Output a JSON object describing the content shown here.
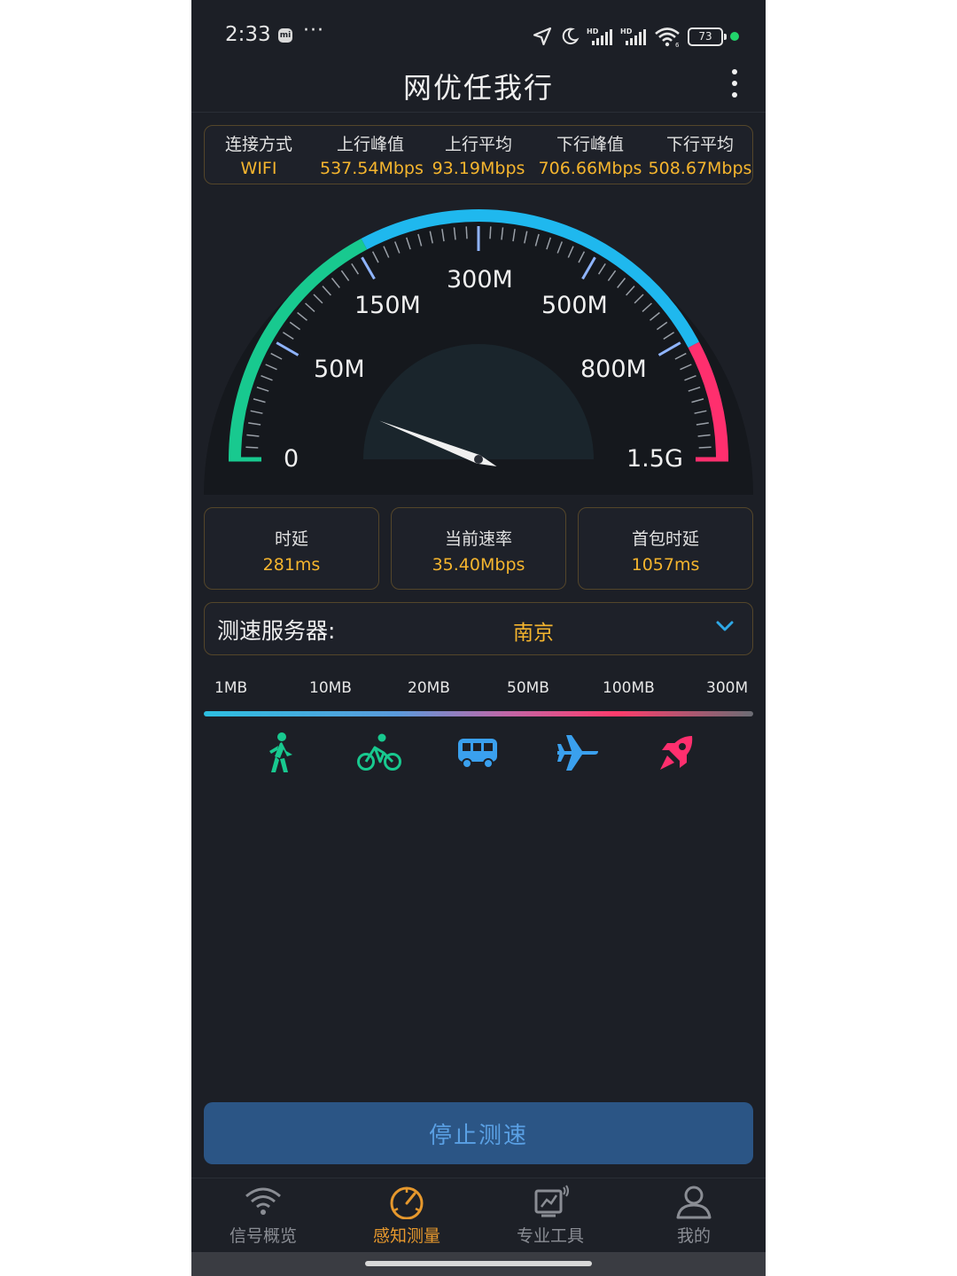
{
  "status_bar": {
    "time": "2:33",
    "ellipsis": "···",
    "battery": "73"
  },
  "app": {
    "title": "网优任我行"
  },
  "summary": {
    "connection_label": "连接方式",
    "connection_value": "WIFI",
    "up_peak_label": "上行峰值",
    "up_peak_value": "537.54Mbps",
    "up_avg_label": "上行平均",
    "up_avg_value": "93.19Mbps",
    "down_peak_label": "下行峰值",
    "down_peak_value": "706.66Mbps",
    "down_avg_label": "下行平均",
    "down_avg_value": "508.67Mbps"
  },
  "gauge": {
    "scale_labels": [
      "0",
      "50M",
      "150M",
      "300M",
      "500M",
      "800M",
      "1.5G"
    ],
    "current_speed_mbps": 35.4,
    "colors": {
      "low": "#18c98f",
      "mid": "#1fb8ee",
      "high": "#ff2f6e"
    }
  },
  "metrics": {
    "latency_label": "时延",
    "latency_value": "281ms",
    "speed_label": "当前速率",
    "speed_value": "35.40Mbps",
    "first_packet_label": "首包时延",
    "first_packet_value": "1057ms"
  },
  "server": {
    "label": "测速服务器:",
    "value": "南京"
  },
  "sizes": [
    "1MB",
    "10MB",
    "20MB",
    "50MB",
    "100MB",
    "300M"
  ],
  "modes": [
    {
      "icon": "walk-icon",
      "color": "#18c98f"
    },
    {
      "icon": "bicycle-icon",
      "color": "#18c98f"
    },
    {
      "icon": "bus-icon",
      "color": "#3aa0ee"
    },
    {
      "icon": "airplane-icon",
      "color": "#3aa0ee"
    },
    {
      "icon": "rocket-icon",
      "color": "#ff2f6e"
    }
  ],
  "action": {
    "stop_label": "停止测速"
  },
  "nav": {
    "items": [
      {
        "label": "信号概览",
        "icon": "wifi-icon"
      },
      {
        "label": "感知测量",
        "icon": "speedometer-icon",
        "active": true
      },
      {
        "label": "专业工具",
        "icon": "tools-monitor-icon"
      },
      {
        "label": "我的",
        "icon": "person-icon"
      }
    ]
  }
}
